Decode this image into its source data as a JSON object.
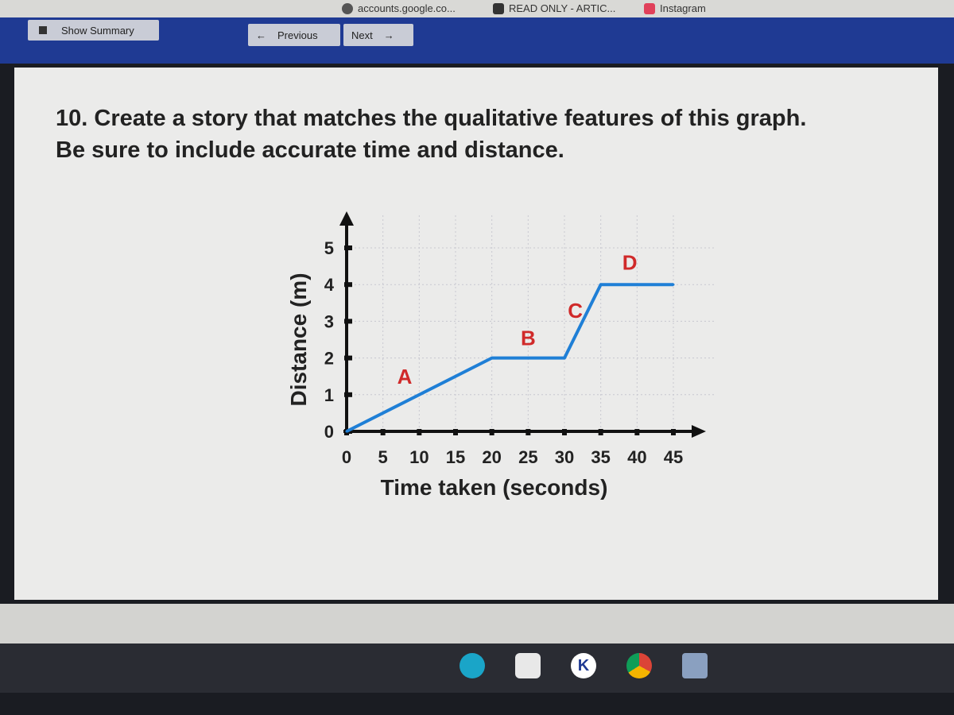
{
  "browser": {
    "bookmarks": [
      {
        "label": "accounts.google.co...",
        "icon": "globe-icon"
      },
      {
        "label": "READ ONLY - ARTIC...",
        "icon": "document-icon"
      },
      {
        "label": "Instagram",
        "icon": "instagram-icon"
      }
    ]
  },
  "toolbar": {
    "show_summary": "Show Summary",
    "previous": "Previous",
    "next": "Next"
  },
  "question": {
    "line1": "10. Create a story that matches the qualitative features of this graph.",
    "line2": "Be sure to include accurate time and distance."
  },
  "colors": {
    "line": "#1f7fd6",
    "segment_labels": "#d02a2a",
    "toolbar": "#1f3a93"
  },
  "chart_data": {
    "type": "line",
    "xlabel": "Time taken (seconds)",
    "ylabel": "Distance (m)",
    "xlim": [
      0,
      45
    ],
    "ylim": [
      0,
      5
    ],
    "xticks": [
      "0",
      "5",
      "10",
      "15",
      "20",
      "25",
      "30",
      "35",
      "40",
      "45"
    ],
    "yticks": [
      "0",
      "1",
      "2",
      "3",
      "4",
      "5"
    ],
    "grid": true,
    "x": [
      0,
      20,
      30,
      35,
      45
    ],
    "y": [
      0,
      2,
      2,
      4,
      4
    ],
    "annotations": [
      {
        "text": "A",
        "x": 8,
        "y": 1.3
      },
      {
        "text": "B",
        "x": 25,
        "y": 2.35
      },
      {
        "text": "C",
        "x": 31.5,
        "y": 3.1
      },
      {
        "text": "D",
        "x": 39,
        "y": 4.4
      }
    ]
  },
  "shelf": {
    "apps": [
      "camera-app-icon",
      "files-app-icon",
      "kahoot-app-icon",
      "chrome-icon",
      "game-app-icon"
    ],
    "kahoot_letter": "K"
  }
}
